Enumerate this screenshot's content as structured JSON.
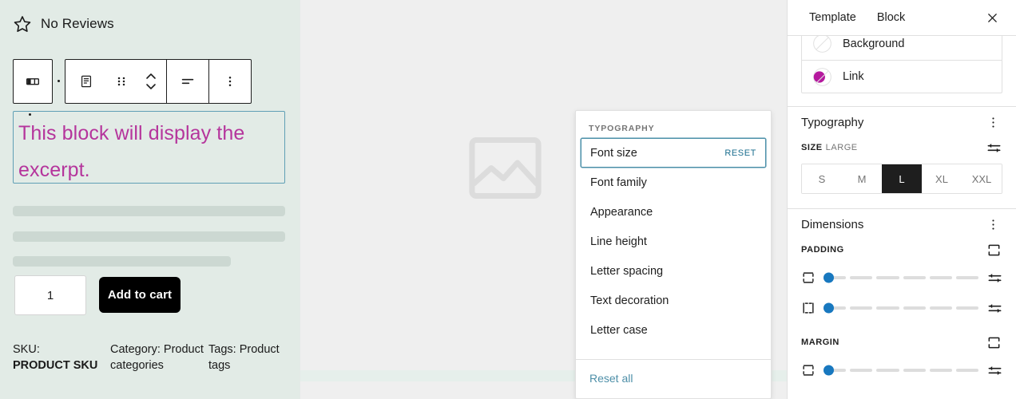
{
  "preview": {
    "reviews_label": "No Reviews",
    "reviews_icon": "star-outline-icon",
    "toolbar": {
      "block_type_icon": "columns-block-icon",
      "paragraph_icon": "paragraph-block-icon",
      "drag_icon": "drag-handle-icon",
      "move_icon": "move-up-down-icon",
      "align_icon": "align-text-icon",
      "options_icon": "more-options-vertical-icon"
    },
    "excerpt_text": "This block will display the excerpt.",
    "excerpt_color": "#b5359e",
    "quantity_value": "1",
    "add_to_cart_label": "Add to cart",
    "meta": {
      "sku_label": "SKU:",
      "sku_value": "PRODUCT SKU",
      "category_label": "Category:",
      "category_value": "Product categories",
      "tags_label": "Tags:",
      "tags_value": "Product tags"
    }
  },
  "canvas": {
    "image_placeholder_icon": "image-placeholder-icon",
    "background_color": "#efefef"
  },
  "typography_popover": {
    "heading": "TYPOGRAPHY",
    "items": [
      {
        "label": "Font size",
        "action": "RESET",
        "selected": true
      },
      {
        "label": "Font family",
        "action": "",
        "selected": false
      },
      {
        "label": "Appearance",
        "action": "",
        "selected": false
      },
      {
        "label": "Line height",
        "action": "",
        "selected": false
      },
      {
        "label": "Letter spacing",
        "action": "",
        "selected": false
      },
      {
        "label": "Text decoration",
        "action": "",
        "selected": false
      },
      {
        "label": "Letter case",
        "action": "",
        "selected": false
      }
    ],
    "reset_all_label": "Reset all",
    "accent_color": "#4e8fa8"
  },
  "sidebar": {
    "tabs": [
      {
        "label": "Template",
        "active": false
      },
      {
        "label": "Block",
        "active": true
      }
    ],
    "close_icon": "close-icon",
    "colors": {
      "rows": [
        {
          "label": "Background",
          "swatch": "empty-swatch",
          "color": ""
        },
        {
          "label": "Link",
          "swatch": "filled-swatch",
          "color": "#b5199e"
        }
      ]
    },
    "typography": {
      "title": "Typography",
      "kebab_icon": "more-options-vertical-icon",
      "size_key": "SIZE",
      "size_value": "LARGE",
      "settings_icon": "slider-settings-icon",
      "size_options": [
        {
          "label": "S",
          "active": false
        },
        {
          "label": "M",
          "active": false
        },
        {
          "label": "L",
          "active": true
        },
        {
          "label": "XL",
          "active": false
        },
        {
          "label": "XXL",
          "active": false
        }
      ]
    },
    "dimensions": {
      "title": "Dimensions",
      "kebab_icon": "more-options-vertical-icon",
      "padding_label": "PADDING",
      "padding_link_icon": "padding-sides-icon",
      "margin_label": "MARGIN",
      "margin_link_icon": "margin-sides-icon",
      "sliders": [
        {
          "name": "padding-vertical",
          "box_icon": "box-top-bottom-icon",
          "value_pct": 2,
          "opts_icon": "slider-settings-icon"
        },
        {
          "name": "padding-horizontal",
          "box_icon": "box-left-right-icon",
          "value_pct": 2,
          "opts_icon": "slider-settings-icon"
        },
        {
          "name": "margin-vertical",
          "box_icon": "box-top-bottom-icon",
          "value_pct": 2,
          "opts_icon": "slider-settings-icon"
        }
      ]
    },
    "accent_blue": "#1878bf"
  }
}
